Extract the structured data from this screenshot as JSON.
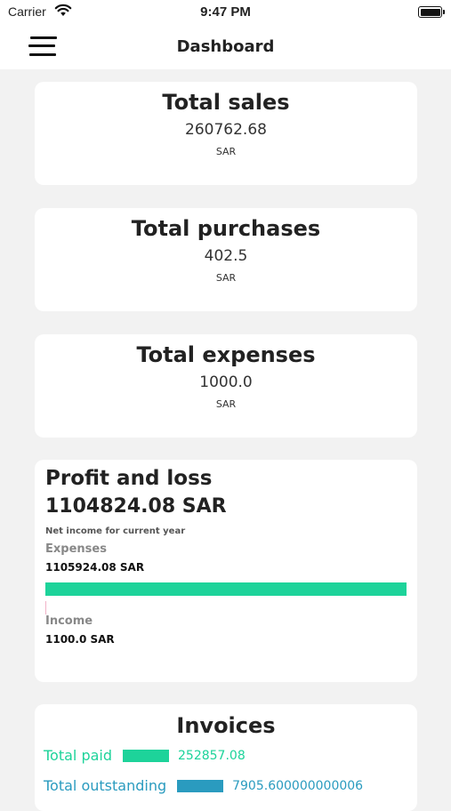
{
  "status_bar": {
    "carrier": "Carrier",
    "time": "9:47 PM"
  },
  "nav": {
    "title": "Dashboard"
  },
  "stats": [
    {
      "title": "Total sales",
      "value": "260762.68",
      "unit": "SAR"
    },
    {
      "title": "Total purchases",
      "value": "402.5",
      "unit": "SAR"
    },
    {
      "title": "Total expenses",
      "value": "1000.0",
      "unit": "SAR"
    }
  ],
  "profit_loss": {
    "title": "Profit and loss",
    "amount": "1104824.08 SAR",
    "note": "Net income for current year",
    "expenses_label": "Expenses",
    "expenses_value": "1105924.08 SAR",
    "income_label": "Income",
    "income_value": "1100.0 SAR",
    "expenses_fraction": 1.0,
    "income_fraction": 0.001,
    "colors": {
      "expenses": "#1dd39a",
      "income": "#f1b3c8"
    }
  },
  "invoices": {
    "title": "Invoices",
    "rows": [
      {
        "label": "Total paid",
        "value": "252857.08",
        "color": "#1dd39a"
      },
      {
        "label": "Total outstanding",
        "value": "7905.600000000006",
        "color": "#2a9bbf"
      }
    ]
  }
}
